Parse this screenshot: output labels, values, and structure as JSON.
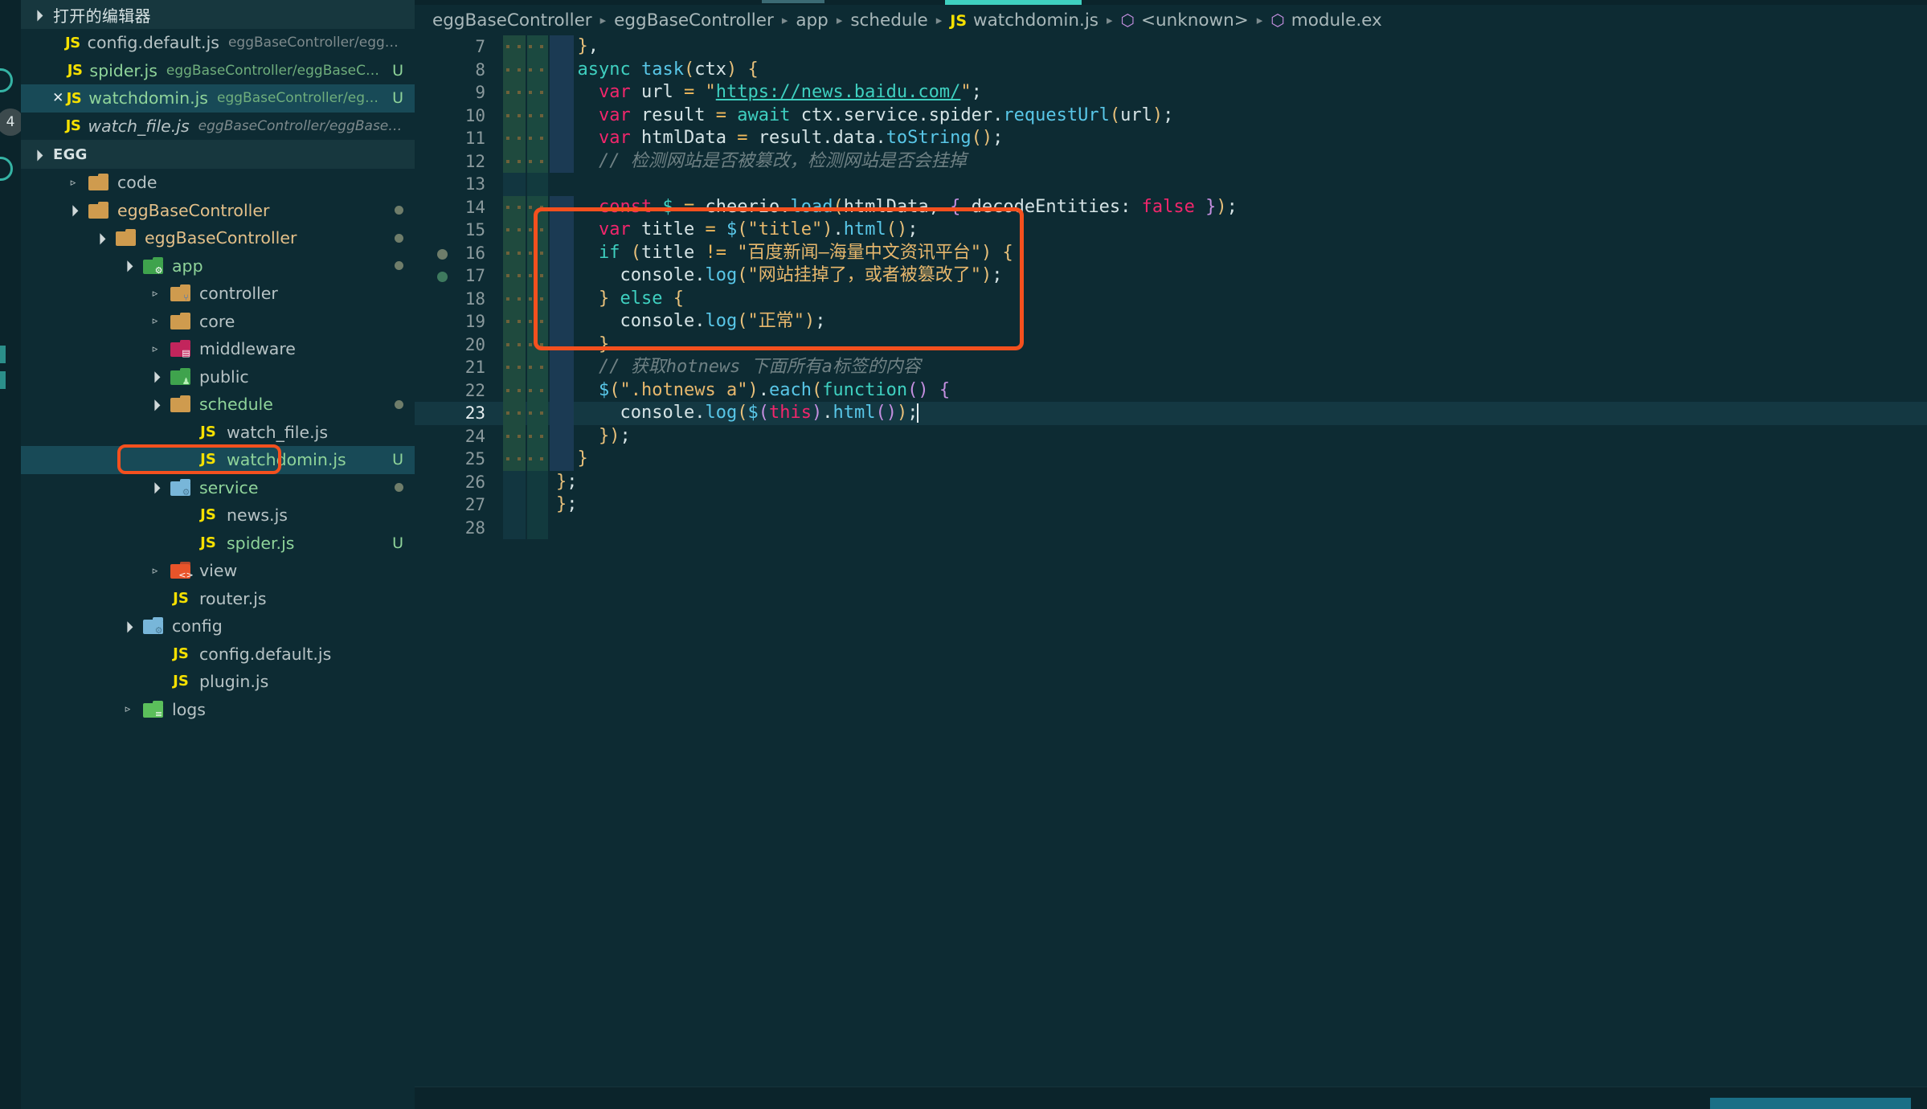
{
  "activity_bar": {
    "badge_count": "4",
    "items": [
      "explorer-icon",
      "search-icon",
      "source-control-icon",
      "debug-icon",
      "extensions-icon"
    ]
  },
  "sidebar": {
    "open_editors": {
      "title": "打开的编辑器",
      "twisty": "expanded",
      "items": [
        {
          "icon": "js-file-icon",
          "name": "config.default.js",
          "path": "eggBaseController/eggBase...",
          "badge": "",
          "state": "normal",
          "closable": false
        },
        {
          "icon": "js-file-icon",
          "name": "spider.js",
          "path": "eggBaseController/eggBaseCo...",
          "badge": "U",
          "state": "normal",
          "closable": false
        },
        {
          "icon": "js-file-icon",
          "name": "watchdomin.js",
          "path": "eggBaseController/eggB...",
          "badge": "U",
          "state": "selected",
          "closable": true
        },
        {
          "icon": "js-file-icon",
          "name": "watch_file.js",
          "path": "eggBaseController/eggBaseCon...",
          "badge": "",
          "state": "preview",
          "closable": false
        }
      ]
    },
    "explorer": {
      "title": "EGG",
      "twisty": "expanded",
      "tree": [
        {
          "label": "code",
          "kind": "folder",
          "icon": "folder-plain-icon",
          "indent": 1,
          "twisty": "closed",
          "color": "grey",
          "badge": ""
        },
        {
          "label": "eggBaseController",
          "kind": "folder",
          "icon": "folder-plain-icon",
          "indent": 1,
          "twisty": "expanded",
          "color": "gold",
          "badge": "dot"
        },
        {
          "label": "eggBaseController",
          "kind": "folder",
          "icon": "folder-plain-icon",
          "indent": 2,
          "twisty": "expanded",
          "color": "gold",
          "badge": "dot"
        },
        {
          "label": "app",
          "kind": "folder",
          "icon": "folder-app-icon",
          "indent": 3,
          "twisty": "expanded",
          "color": "green",
          "badge": "dot"
        },
        {
          "label": "controller",
          "kind": "folder",
          "icon": "folder-controller-icon",
          "indent": 4,
          "twisty": "closed",
          "color": "grey",
          "badge": ""
        },
        {
          "label": "core",
          "kind": "folder",
          "icon": "folder-plain-icon",
          "indent": 4,
          "twisty": "closed",
          "color": "grey",
          "badge": ""
        },
        {
          "label": "middleware",
          "kind": "folder",
          "icon": "folder-middleware-icon",
          "indent": 4,
          "twisty": "closed",
          "color": "grey",
          "badge": ""
        },
        {
          "label": "public",
          "kind": "folder",
          "icon": "folder-public-icon",
          "indent": 4,
          "twisty": "expanded",
          "color": "grey",
          "badge": ""
        },
        {
          "label": "schedule",
          "kind": "folder",
          "icon": "folder-plain-icon",
          "indent": 4,
          "twisty": "expanded",
          "color": "green",
          "badge": "dot"
        },
        {
          "label": "watch_file.js",
          "kind": "file",
          "icon": "js-file-icon",
          "indent": 5,
          "twisty": "none",
          "color": "grey",
          "badge": ""
        },
        {
          "label": "watchdomin.js",
          "kind": "file",
          "icon": "js-file-icon",
          "indent": 5,
          "twisty": "none",
          "color": "green",
          "badge": "U",
          "selected": true,
          "annotated": true
        },
        {
          "label": "service",
          "kind": "folder",
          "icon": "folder-service-icon",
          "indent": 4,
          "twisty": "expanded",
          "color": "green",
          "badge": "dot"
        },
        {
          "label": "news.js",
          "kind": "file",
          "icon": "js-file-icon",
          "indent": 5,
          "twisty": "none",
          "color": "grey",
          "badge": ""
        },
        {
          "label": "spider.js",
          "kind": "file",
          "icon": "js-file-icon",
          "indent": 5,
          "twisty": "none",
          "color": "green",
          "badge": "U"
        },
        {
          "label": "view",
          "kind": "folder",
          "icon": "folder-view-icon",
          "indent": 4,
          "twisty": "closed",
          "color": "grey",
          "badge": ""
        },
        {
          "label": "router.js",
          "kind": "file",
          "icon": "js-file-icon",
          "indent": 4,
          "twisty": "none",
          "color": "grey",
          "badge": ""
        },
        {
          "label": "config",
          "kind": "folder",
          "icon": "folder-config-icon",
          "indent": 3,
          "twisty": "expanded",
          "color": "grey",
          "badge": ""
        },
        {
          "label": "config.default.js",
          "kind": "file",
          "icon": "js-file-icon",
          "indent": 4,
          "twisty": "none",
          "color": "grey",
          "badge": ""
        },
        {
          "label": "plugin.js",
          "kind": "file",
          "icon": "js-file-icon",
          "indent": 4,
          "twisty": "none",
          "color": "grey",
          "badge": ""
        },
        {
          "label": "logs",
          "kind": "folder",
          "icon": "folder-logs-icon",
          "indent": 3,
          "twisty": "closed",
          "color": "grey",
          "badge": ""
        }
      ]
    }
  },
  "breadcrumbs": [
    {
      "label": "eggBaseController",
      "icon": ""
    },
    {
      "label": "eggBaseController",
      "icon": ""
    },
    {
      "label": "app",
      "icon": ""
    },
    {
      "label": "schedule",
      "icon": ""
    },
    {
      "label": "watchdomin.js",
      "icon": "js-file-icon"
    },
    {
      "label": "<unknown>",
      "icon": "symbol-cube-icon"
    },
    {
      "label": "module.ex",
      "icon": "symbol-cube-icon"
    }
  ],
  "editor": {
    "language": "javascript",
    "active_line": 23,
    "first_visible_line": 7,
    "last_visible_line": 28,
    "lines": [
      {
        "n": 7,
        "text": "  },",
        "diff": "green"
      },
      {
        "n": 8,
        "text": "  async task(ctx) {",
        "diff": "green"
      },
      {
        "n": 9,
        "text": "    var url = \"https://news.baidu.com/\";",
        "diff": "green"
      },
      {
        "n": 10,
        "text": "    var result = await ctx.service.spider.requestUrl(url);",
        "diff": "green"
      },
      {
        "n": 11,
        "text": "    var htmlData = result.data.toString();",
        "diff": "green"
      },
      {
        "n": 12,
        "text": "    // 检测网站是否被篡改，检测网站是否会挂掉",
        "diff": "green"
      },
      {
        "n": 13,
        "text": "",
        "diff": "none"
      },
      {
        "n": 14,
        "text": "    const $ = cheerio.load(htmlData, { decodeEntities: false });",
        "diff": "green"
      },
      {
        "n": 15,
        "text": "    var title = $(\"title\").html();",
        "diff": "green"
      },
      {
        "n": 16,
        "text": "    if (title != \"百度新闻—海量中文资讯平台\") {",
        "diff": "green",
        "breakpoint": "grey"
      },
      {
        "n": 17,
        "text": "      console.log(\"网站挂掉了，或者被篡改了\");",
        "diff": "green",
        "breakpoint": "green"
      },
      {
        "n": 18,
        "text": "    } else {",
        "diff": "green"
      },
      {
        "n": 19,
        "text": "      console.log(\"正常\");",
        "diff": "green"
      },
      {
        "n": 20,
        "text": "    }",
        "diff": "green"
      },
      {
        "n": 21,
        "text": "    // 获取hotnews 下面所有a标签的内容",
        "diff": "green"
      },
      {
        "n": 22,
        "text": "    $(\".hotnews a\").each(function() {",
        "diff": "green"
      },
      {
        "n": 23,
        "text": "      console.log($(this).html());",
        "diff": "green",
        "current": true
      },
      {
        "n": 24,
        "text": "    });",
        "diff": "green"
      },
      {
        "n": 25,
        "text": "  }",
        "diff": "green"
      },
      {
        "n": 26,
        "text": "};",
        "diff": "none"
      },
      {
        "n": 27,
        "text": "};",
        "diff": "none"
      },
      {
        "n": 28,
        "text": "",
        "diff": "none"
      }
    ]
  },
  "annotations": [
    {
      "name": "code-highlight-box",
      "color": "#f4501e",
      "target": "lines 15-20"
    },
    {
      "name": "tree-file-highlight-box",
      "color": "#f4501e",
      "target": "watchdomin.js"
    }
  ],
  "colors": {
    "editor_bg": "#0d2b33",
    "sidebar_bg": "#0d2b33",
    "selection_bg": "#184a57",
    "accent": "#3fd0c0",
    "annotation": "#f4501e",
    "keyword": "#f2266c",
    "string": "#e8b86d",
    "function": "#59c7e8",
    "comment": "#6f8184"
  }
}
